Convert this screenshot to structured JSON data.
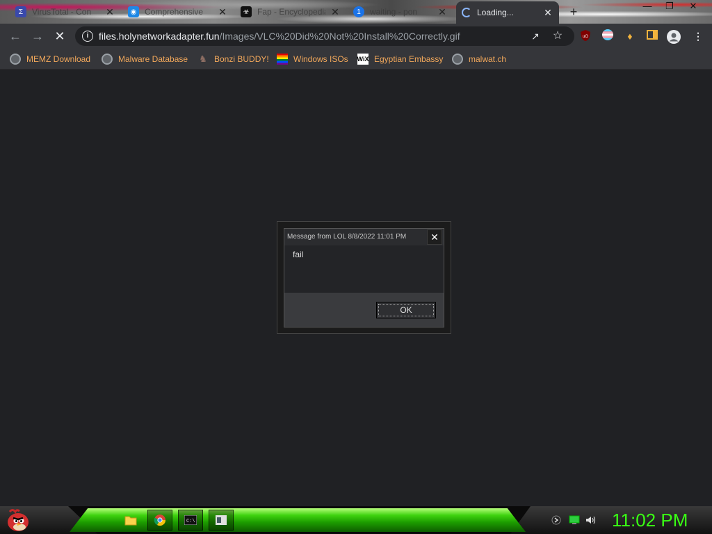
{
  "browser": {
    "tabs": [
      {
        "title": "VirusTotal - Con",
        "favicon": "virustotal-icon",
        "active": false
      },
      {
        "title": "Comprehensive",
        "favicon": "location-pin-icon",
        "active": false
      },
      {
        "title": "Fap - Encyclopedia",
        "favicon": "encyclopedia-icon",
        "active": false
      },
      {
        "title": "waiting - pon",
        "favicon": "notification-icon",
        "active": false
      },
      {
        "title": "Loading...",
        "favicon": "loading-spinner-icon",
        "active": true
      }
    ],
    "address": {
      "host": "files.holynetworkadapter.fun",
      "path": "/Images/VLC%20Did%20Not%20Install%20Correctly.gif"
    },
    "bookmarks": [
      {
        "label": "MEMZ Download",
        "icon": "globe-icon"
      },
      {
        "label": "Malware Database",
        "icon": "globe-icon"
      },
      {
        "label": "Bonzi BUDDY!",
        "icon": "bonzi-icon"
      },
      {
        "label": "Windows ISOs",
        "icon": "rainbow-flag-icon"
      },
      {
        "label": "Egyptian Embassy",
        "icon": "wix-icon",
        "icon_text": "WiX"
      },
      {
        "label": "malwat.ch",
        "icon": "globe-icon"
      }
    ]
  },
  "dialog": {
    "title": "Message from LOL 8/8/2022 11:01 PM",
    "message": "fail",
    "ok_label": "OK"
  },
  "taskbar": {
    "clock": "11:02 PM",
    "apps": [
      "file-explorer-icon",
      "chrome-icon",
      "command-prompt-icon",
      "window-icon"
    ]
  },
  "colors": {
    "bookmark_text": "#f2a85b",
    "clock": "#39ff14",
    "taskbar_green": "#3ed20f"
  }
}
